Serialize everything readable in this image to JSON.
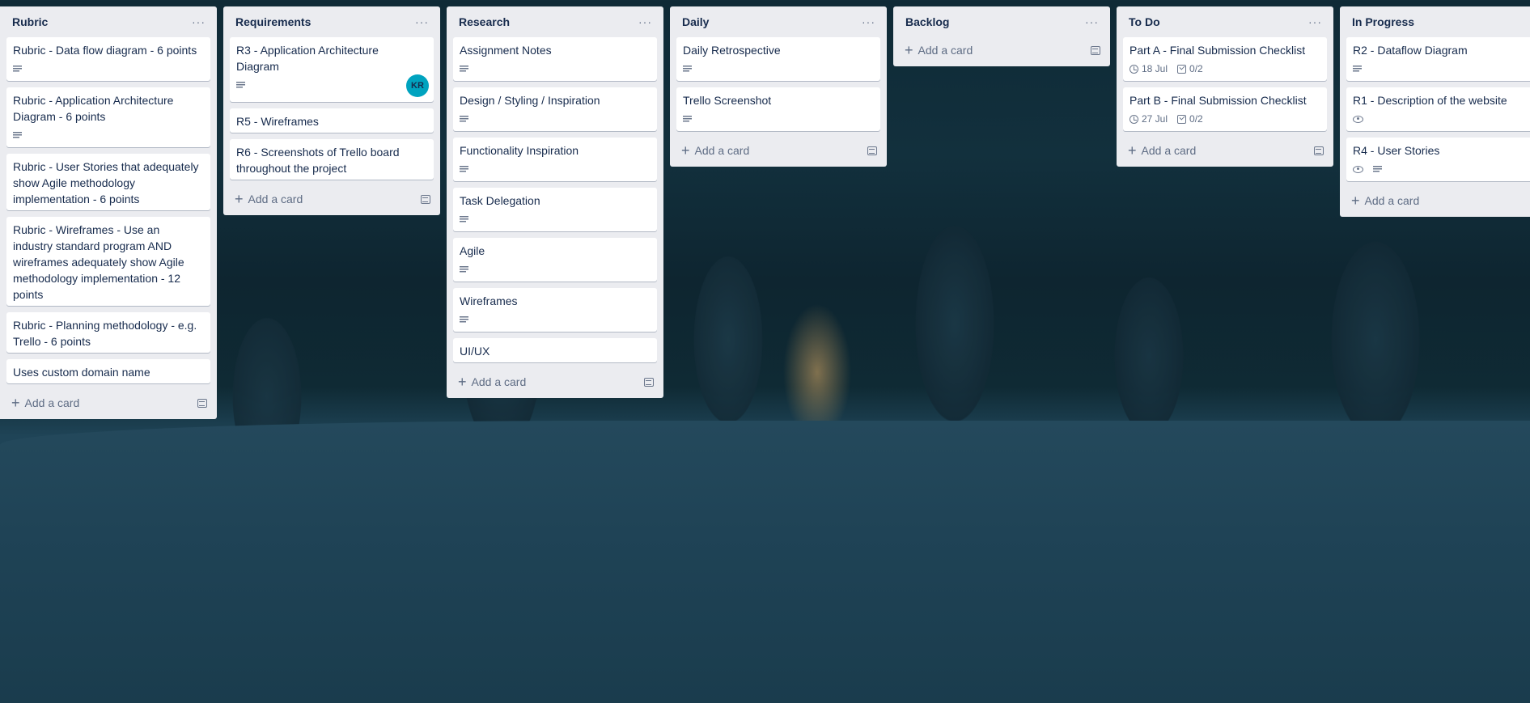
{
  "lists": [
    {
      "title": "Rubric",
      "menu": "···",
      "cards": [
        {
          "title": "Rubric - Data flow diagram - 6 points",
          "desc": true
        },
        {
          "title": "Rubric - Application Architecture Diagram - 6 points",
          "desc": true
        },
        {
          "title": "Rubric - User Stories that adequately show Agile methodology implementation - 6 points",
          "desc": false
        },
        {
          "title": "Rubric - Wireframes - Use an industry standard program AND wireframes adequately show Agile methodology implementation - 12 points",
          "desc": false
        },
        {
          "title": "Rubric - Planning methodology - e.g. Trello - 6 points",
          "desc": false
        },
        {
          "title": "Uses custom domain name",
          "desc": false
        }
      ],
      "add_label": "Add a card"
    },
    {
      "title": "Requirements",
      "menu": "···",
      "cards": [
        {
          "title": "R3 - Application Architecture Diagram",
          "desc": true,
          "avatar": "KR"
        },
        {
          "title": "R5 - Wireframes",
          "desc": false
        },
        {
          "title": "R6 - Screenshots of Trello board throughout the project",
          "desc": false
        }
      ],
      "add_label": "Add a card"
    },
    {
      "title": "Research",
      "menu": "···",
      "cards": [
        {
          "title": "Assignment Notes",
          "desc": true
        },
        {
          "title": "Design / Styling / Inspiration",
          "desc": true
        },
        {
          "title": "Functionality Inspiration",
          "desc": true
        },
        {
          "title": "Task Delegation",
          "desc": true
        },
        {
          "title": "Agile",
          "desc": true
        },
        {
          "title": "Wireframes",
          "desc": true
        },
        {
          "title": "UI/UX",
          "desc": false
        }
      ],
      "add_label": "Add a card"
    },
    {
      "title": "Daily",
      "menu": "···",
      "cards": [
        {
          "title": "Daily Retrospective",
          "desc": true
        },
        {
          "title": "Trello Screenshot",
          "desc": true
        }
      ],
      "add_label": "Add a card"
    },
    {
      "title": "Backlog",
      "menu": "···",
      "cards": [],
      "add_label": "Add a card"
    },
    {
      "title": "To Do",
      "menu": "···",
      "cards": [
        {
          "title": "Part A - Final Submission Checklist",
          "due": "18 Jul",
          "checklist": "0/2"
        },
        {
          "title": "Part B - Final Submission Checklist",
          "due": "27 Jul",
          "checklist": "0/2"
        }
      ],
      "add_label": "Add a card"
    },
    {
      "title": "In Progress",
      "menu": "···",
      "cards": [
        {
          "title": "R2 - Dataflow Diagram",
          "desc": true
        },
        {
          "title": "R1 - Description of the website",
          "watch": true
        },
        {
          "title": "R4 - User Stories",
          "watch": true,
          "desc": true
        }
      ],
      "add_label": "Add a card"
    }
  ]
}
